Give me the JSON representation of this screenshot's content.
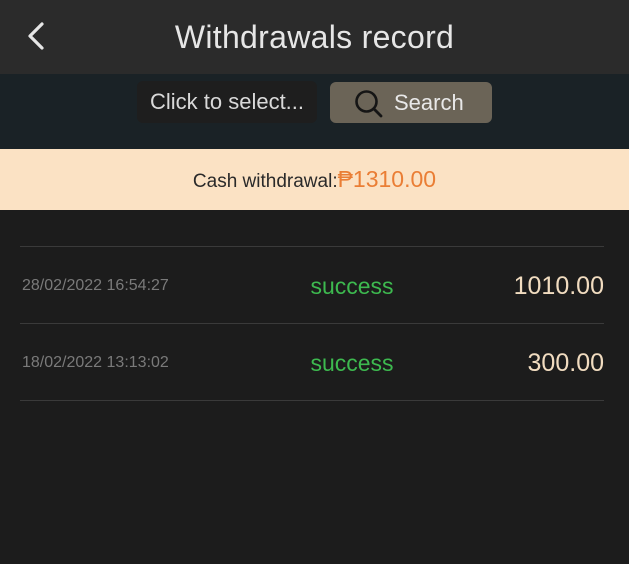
{
  "header": {
    "title": "Withdrawals record",
    "back_icon": "chevron-left-icon"
  },
  "filter": {
    "select_placeholder": "Click to select...",
    "search_label": "Search",
    "search_icon": "search-icon"
  },
  "summary": {
    "label": "Cash withdrawal:",
    "amount": "₱1310.00"
  },
  "records": [
    {
      "date": "28/02/2022 16:54:27",
      "status": "success",
      "amount": "1010.00"
    },
    {
      "date": "18/02/2022 13:13:02",
      "status": "success",
      "amount": "300.00"
    }
  ],
  "colors": {
    "background": "#1c1c1c",
    "header": "#2b2b2b",
    "summary_bg": "#fbe2c4",
    "accent_orange": "#ea7e35",
    "status_green": "#3db94f",
    "amount_text": "#f1dcc0",
    "search_button": "#6b6457"
  }
}
